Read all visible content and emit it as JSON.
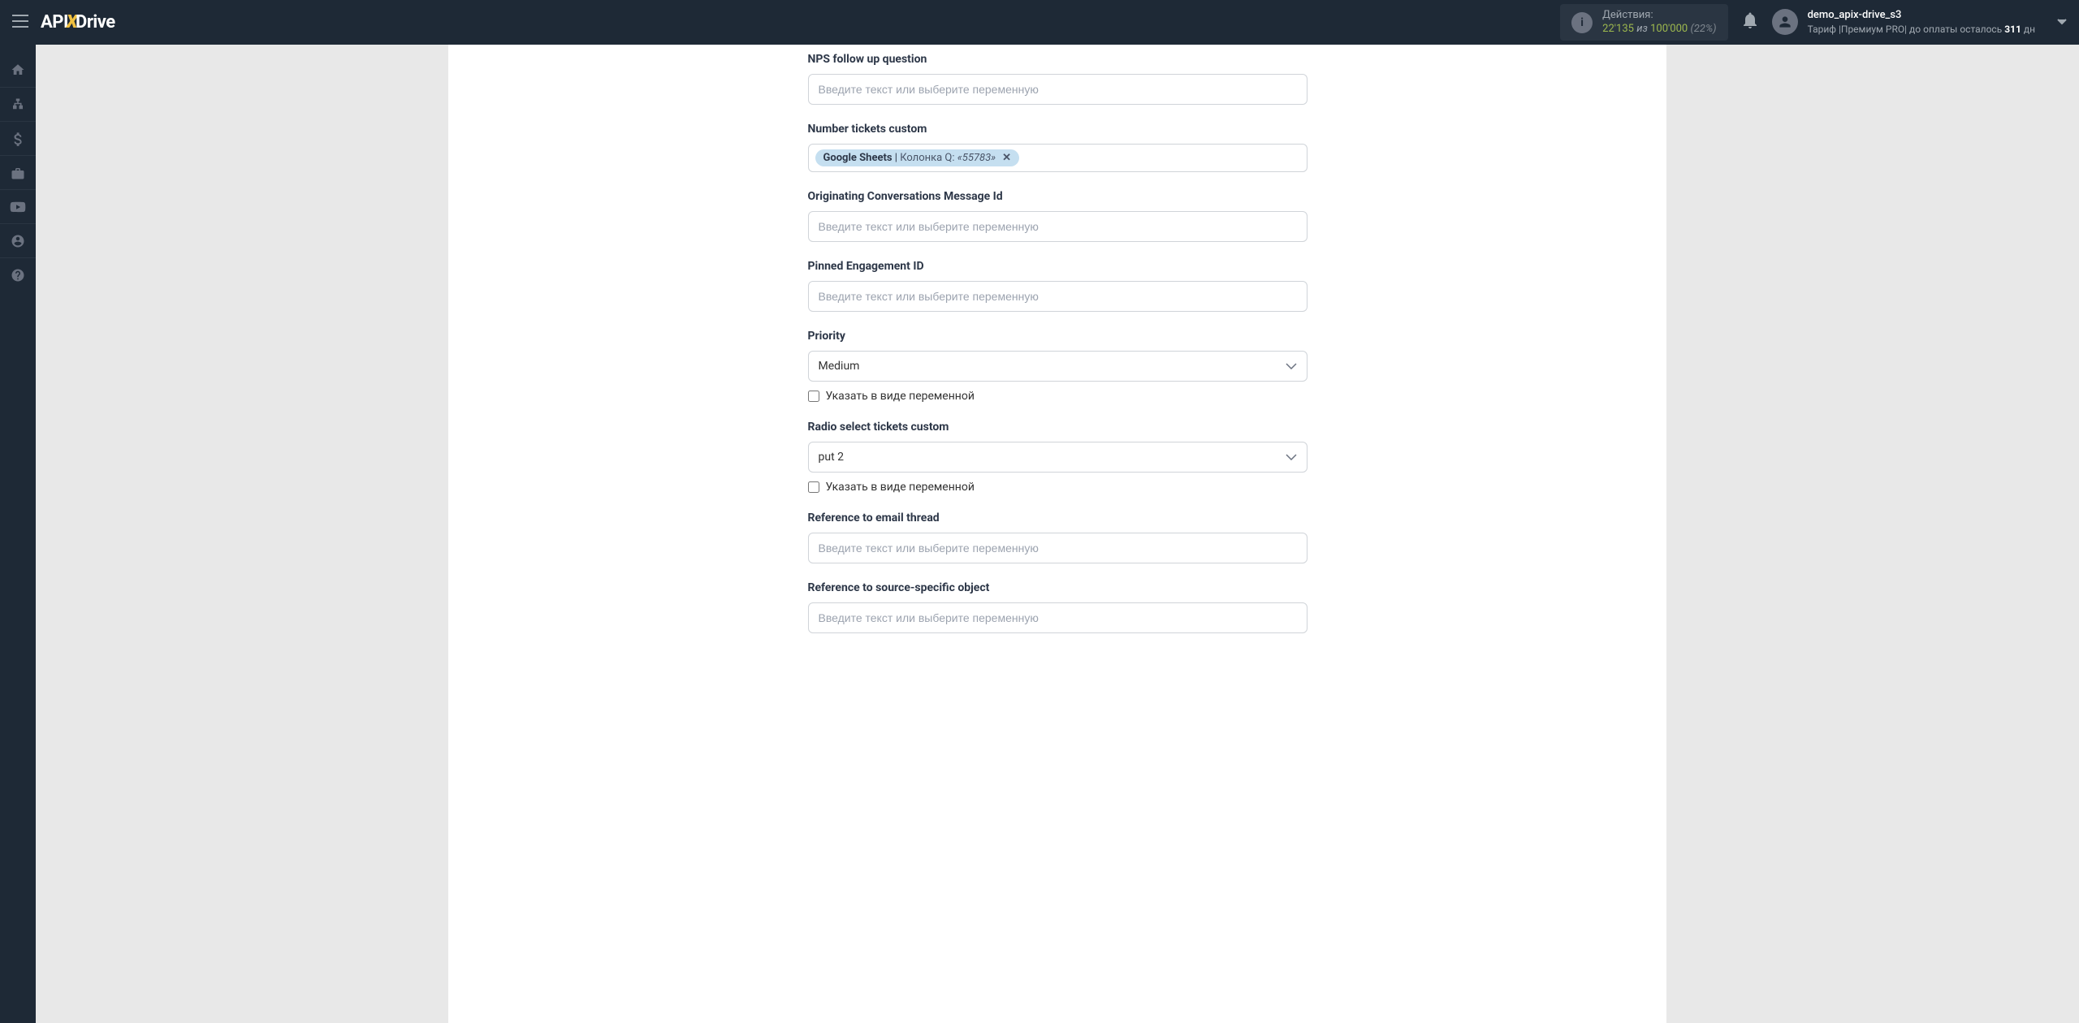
{
  "header": {
    "logo": {
      "part1": "API",
      "part2": "X",
      "part3": "Drive"
    },
    "actions": {
      "label": "Действия:",
      "count": "22'135",
      "iz": "из",
      "total": "100'000",
      "percent": "(22%)"
    },
    "user": {
      "name": "demo_apix-drive_s3",
      "tariff_prefix": "Тариф |Премиум PRO| до оплаты осталось ",
      "days": "311",
      "days_suffix": " дн"
    }
  },
  "form": {
    "placeholder_text": "Введите текст или выберите переменную",
    "checkbox_label": "Указать в виде переменной",
    "fields": {
      "nps_followup": {
        "label": "NPS follow up question"
      },
      "number_tickets": {
        "label": "Number tickets custom",
        "tag": {
          "source": "Google Sheets",
          "divider": " | ",
          "field": "Колонка Q: ",
          "value": "«55783»"
        }
      },
      "originating_msg": {
        "label": "Originating Conversations Message Id"
      },
      "pinned_engagement": {
        "label": "Pinned Engagement ID"
      },
      "priority": {
        "label": "Priority",
        "value": "Medium"
      },
      "radio_select": {
        "label": "Radio select tickets custom",
        "value": "put 2"
      },
      "ref_email": {
        "label": "Reference to email thread"
      },
      "ref_source": {
        "label": "Reference to source-specific object"
      }
    }
  }
}
